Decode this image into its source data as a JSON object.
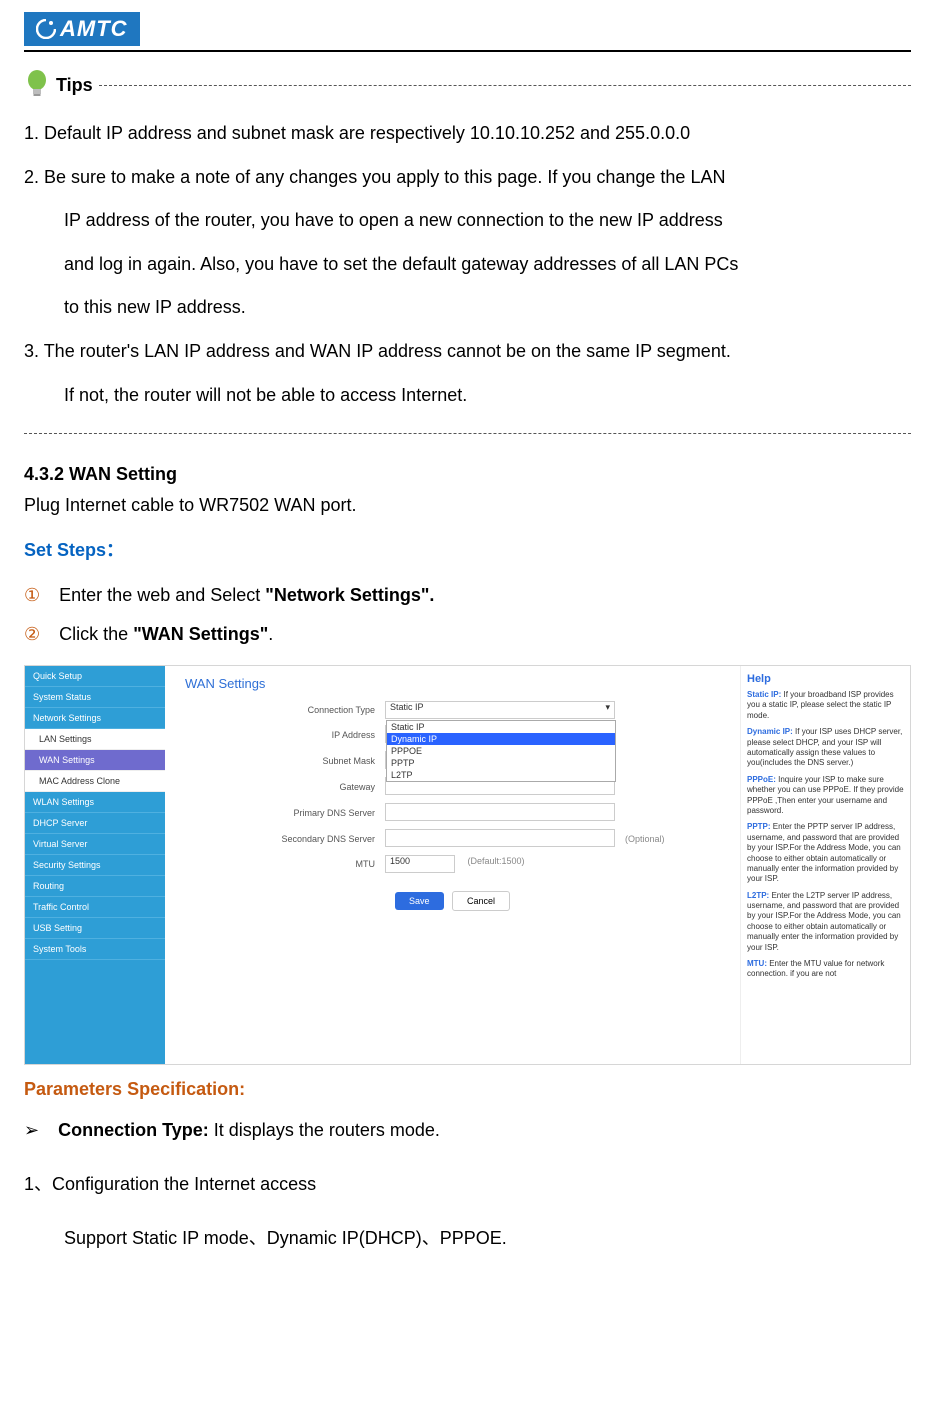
{
  "logo_text": "AMTC",
  "tips": {
    "label": "Tips",
    "t1": "1. Default IP address and subnet mask are respectively 10.10.10.252 and 255.0.0.0",
    "t2a": "2. Be sure to make a note of any changes you apply to this page. If you change the LAN",
    "t2b": "IP address of the router, you have to open a new connection to the new IP address",
    "t2c": "and log in again. Also, you have to set the default gateway addresses of all LAN PCs",
    "t2d": "to this new IP address.",
    "t3a": "3. The router's LAN IP address and WAN IP address cannot be on the same IP segment.",
    "t3b": "If not, the router will not be able to access Internet."
  },
  "section": {
    "head": "4.3.2 WAN Setting",
    "intro": "Plug Internet cable to WR7502 WAN port.",
    "steps_label": "Set Steps：",
    "c1": "①",
    "c2": "②",
    "s1_pre": "Enter the web and Select ",
    "s1_bold": "\"Network Settings\".",
    "s2_pre": "Click the ",
    "s2_bold": "\"WAN Settings\"",
    "s2_post": "."
  },
  "ui": {
    "side": {
      "quick": "Quick Setup",
      "status": "System Status",
      "net": "Network Settings",
      "lan": "LAN Settings",
      "wan": "WAN Settings",
      "mac": "MAC Address Clone",
      "wlan": "WLAN Settings",
      "dhcp": "DHCP Server",
      "vs": "Virtual Server",
      "sec": "Security Settings",
      "rout": "Routing",
      "tc": "Traffic Control",
      "usb": "USB Setting",
      "tools": "System Tools"
    },
    "wan_title": "WAN Settings",
    "labels": {
      "conn": "Connection Type",
      "ip": "IP Address",
      "mask": "Subnet Mask",
      "gw": "Gateway",
      "dns1": "Primary DNS Server",
      "dns2": "Secondary DNS Server",
      "mtu": "MTU"
    },
    "conn_value": "Static IP",
    "dd": {
      "o1": "Static IP",
      "o2": "Dynamic IP",
      "o3": "PPPOE",
      "o4": "PPTP",
      "o5": "L2TP"
    },
    "optional": "(Optional)",
    "mtu_val": "1500",
    "mtu_note": "(Default:1500)",
    "save": "Save",
    "cancel": "Cancel",
    "help": {
      "head": "Help",
      "static": "Static IP: If your broadband ISP provides you a static IP, please select the static IP mode.",
      "dyn": "Dynamic IP: If your ISP uses DHCP server, please select DHCP, and your ISP will automatically assign these values to you(includes the DNS server.)",
      "ppp": "PPPoE: Inquire your ISP to make sure whether you can use PPPoE. If they provide PPPoE ,Then enter your username and password.",
      "pptp": "PPTP: Enter the PPTP server IP address, username, and password that are provided by your ISP.For the Address Mode, you can choose to either obtain automatically or manually enter the information provided by your ISP.",
      "l2tp": "L2TP: Enter the L2TP server IP address, username, and password that are provided by your ISP.For the Address Mode, you can choose to either obtain automatically or manually enter the information provided by your ISP.",
      "mtu": "MTU: Enter the MTU value for network connection. if you are not"
    }
  },
  "params": {
    "head": "Parameters Specification:",
    "chev": "➢",
    "ct_bold": "Connection Type: ",
    "ct_text": "It displays the routers mode.",
    "l1": "1、Configuration the Internet access",
    "l2": "Support Static IP mode、Dynamic IP(DHCP)、PPPOE."
  }
}
